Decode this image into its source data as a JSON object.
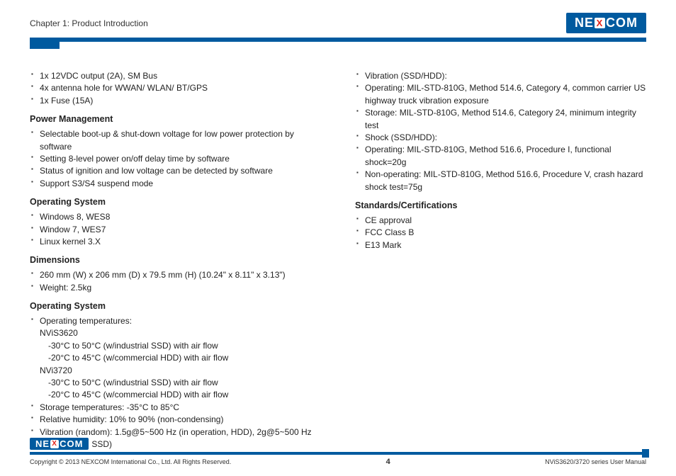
{
  "header": {
    "chapter": "Chapter 1: Product Introduction",
    "logo_left": "NE",
    "logo_mid": "X",
    "logo_right": "COM"
  },
  "col1": {
    "top_items": [
      "1x 12VDC output (2A), SM Bus",
      "4x antenna hole for WWAN/ WLAN/ BT/GPS",
      "1x Fuse (15A)"
    ],
    "power_heading": "Power Management",
    "power_items": [
      "Selectable boot-up & shut-down voltage for low power protection by software",
      "Setting 8-level power on/off delay time by software",
      "Status of ignition and low voltage can be detected by software",
      "Support S3/S4 suspend mode"
    ],
    "os_heading": "Operating System",
    "os_items": [
      "Windows 8, WES8",
      "Window 7, WES7",
      "Linux kernel 3.X"
    ],
    "dim_heading": "Dimensions",
    "dim_items": [
      "260 mm (W) x 206 mm (D) x 79.5 mm (H) (10.24\" x 8.11\" x 3.13\")",
      "Weight: 2.5kg"
    ],
    "env_heading": "Operating System",
    "env_temp_label": "Operating temperatures:",
    "env_model1": "NViS3620",
    "env_model1_l1": "-30°C to 50°C (w/industrial SSD) with air flow",
    "env_model1_l2": "-20°C to 45°C (w/commercial HDD) with air flow",
    "env_model2": "NVi3720",
    "env_model2_l1": "-30°C to 50°C (w/industrial SSD) with air flow",
    "env_model2_l2": "-20°C to 45°C (w/commercial HDD) with air flow",
    "env_rest": [
      "Storage temperatures: -35°C to 85°C",
      "Relative humidity: 10% to 90% (non-condensing)",
      "Vibration (random): 1.5g@5~500 Hz (in operation, HDD), 2g@5~500 Hz (in operation, SSD)"
    ]
  },
  "col2": {
    "top_items": [
      "Vibration (SSD/HDD):",
      "Operating: MIL-STD-810G, Method 514.6, Category 4, common carrier US highway truck vibration exposure",
      "Storage: MIL-STD-810G, Method 514.6, Category 24, minimum integrity test",
      "Shock (SSD/HDD):",
      "Operating: MIL-STD-810G, Method 516.6, Procedure I, functional shock=20g",
      "Non-operating: MIL-STD-810G, Method 516.6, Procedure V, crash hazard shock test=75g"
    ],
    "std_heading": "Standards/Certifications",
    "std_items": [
      "CE approval",
      "FCC Class B",
      "E13 Mark"
    ]
  },
  "footer": {
    "copyright": "Copyright © 2013 NEXCOM International Co., Ltd. All Rights Reserved.",
    "page": "4",
    "doc": "NViS3620/3720 series User Manual"
  }
}
